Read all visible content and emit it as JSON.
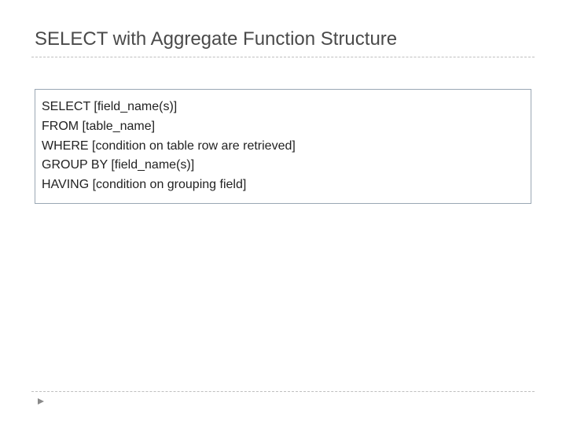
{
  "title": "SELECT with Aggregate Function Structure",
  "code": {
    "line1_kw": "SELECT",
    "line1_rest": " [field_name(s)]",
    "line2_kw": "FROM",
    "line2_rest": " [table_name]",
    "line3_kw": "WHERE",
    "line3_rest": " [condition on table row are retrieved]",
    "line4_kw": "GROUP BY",
    "line4_rest": " [field_name(s)]",
    "line5_kw": "HAVING",
    "line5_rest": " [condition on grouping field]"
  }
}
